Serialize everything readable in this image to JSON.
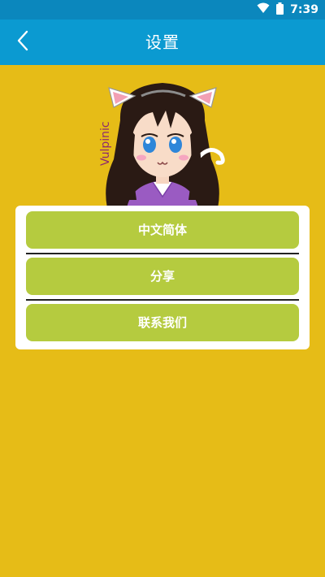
{
  "status_bar": {
    "time": "7:39",
    "icons": [
      "wifi-icon",
      "battery-icon"
    ]
  },
  "header": {
    "title": "设置",
    "back_icon": "chevron-left-icon"
  },
  "mascot": {
    "signature": "Vulpinic"
  },
  "menu": {
    "items": [
      {
        "label": "中文简体"
      },
      {
        "label": "分享"
      },
      {
        "label": "联系我们"
      }
    ]
  },
  "colors": {
    "status_bar": "#0B87BD",
    "app_bar": "#0B9AD1",
    "background": "#E6BC17",
    "button": "#B5CB3F",
    "card": "#FFFFFF"
  }
}
